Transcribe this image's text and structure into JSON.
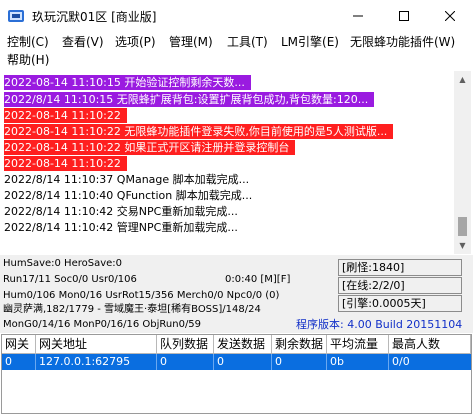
{
  "window": {
    "title": "玖玩沉默01区 [商业版]",
    "controls": {
      "minimize": "—",
      "maximize": "☐",
      "close": "✕"
    }
  },
  "menu": [
    "控制(C)",
    "查看(V)",
    "选项(P)",
    "管理(M)",
    "工具(T)",
    "LM引擎(E)",
    "无限蜂功能插件(W)",
    "帮助(H)"
  ],
  "log": [
    {
      "text": "2022-08-14 11:10:15 开始验证控制剩余天数...",
      "style": "purple"
    },
    {
      "text": "2022/8/14 11:10:15 无限蜂扩展背包:设置扩展背包成功,背包数量:120...",
      "style": "purple"
    },
    {
      "text": "2022-08-14 11:10:22",
      "style": "red"
    },
    {
      "text": "2022-08-14 11:10:22 无限蜂功能插件登录失败,你目前使用的是5人测试版...",
      "style": "red"
    },
    {
      "text": "2022-08-14 11:10:22 如果正式开区请注册并登录控制台",
      "style": "red"
    },
    {
      "text": "2022-08-14 11:10:22",
      "style": "red"
    },
    {
      "text": "2022/8/14 11:10:37 QManage 脚本加载完成...",
      "style": "plain"
    },
    {
      "text": "2022/8/14 11:10:40 QFunction 脚本加载完成...",
      "style": "plain"
    },
    {
      "text": "2022/8/14 11:10:42 交易NPC重新加载完成...",
      "style": "plain"
    },
    {
      "text": "2022/8/14 11:10:42 管理NPC重新加载完成...",
      "style": "plain"
    }
  ],
  "status": {
    "line1": "HumSave:0 HeroSave:0",
    "line2a": "Run17/11 Soc0/0 Usr0/106",
    "line2b": "0:0:40 [M][F]",
    "line3": "Hum0/106 Mon0/16 UsrRot15/356 Merch0/0 Npc0/0 (0)",
    "line4": "幽灵萨满,182/1779 - 雪域魔王·泰坦[稀有BOSS]/148/24",
    "line5": "MonG0/14/16 MonP0/16/16 ObjRun0/59",
    "refresh": "[刷怪:1840]",
    "online": "[在线:2/2/0]",
    "engine": "[引擎:0.0005天]",
    "version": "程序版本: 4.00 Build 20151104"
  },
  "gateway": {
    "headers": [
      "网关",
      "网关地址",
      "队列数据",
      "发送数据",
      "剩余数据",
      "平均流量",
      "最高人数"
    ],
    "rows": [
      [
        "0",
        "127.0.0.1:62795",
        "0",
        "0",
        "0",
        "0b",
        "0/0"
      ]
    ]
  },
  "colors": {
    "log_purple": "#9a1be0",
    "log_red": "#ff1f1f",
    "version_blue": "#1230c8",
    "row_selected": "#0a6ee0"
  }
}
